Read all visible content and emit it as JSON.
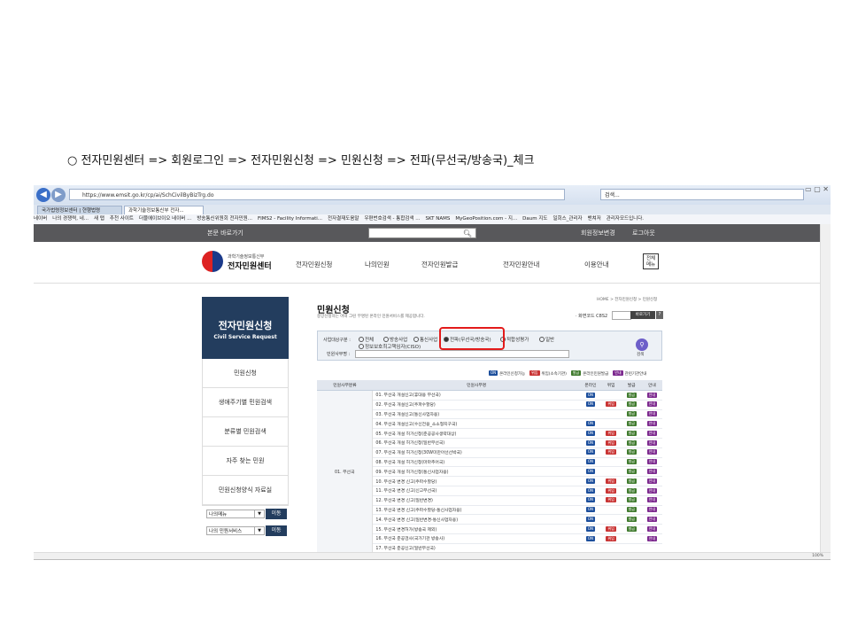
{
  "caption": "○  전자민원센터 => 회원로그인 => 전자민원신청 => 민원신청 => 전파(무선국/방송국)_체크",
  "browser": {
    "back_icon": "back-arrow-icon",
    "url": "https://www.emsit.go.kr/cp/ai/SchCivilByBizTrg.do",
    "search_placeholder": "검색...",
    "tabs": [
      "국가법령정보센터 | 현행법령",
      "과학기술정보통신부 전자..."
    ],
    "favorites": [
      "네이버",
      "나의 경쟁력, 네...",
      "새 탭",
      "추천 사이트",
      "더블에이브이오 네이버 ...",
      "방송통신위원회 전자민원...",
      "FIMS2 - Facility Informati...",
      "전자결재도움말",
      "우편번호검색 - 통합검색 ...",
      "SKT NAMS",
      "MyGeoPosition.com - 지...",
      "Daum 지도",
      "일회스_관리자",
      "밴쳐저",
      "관리자모드입니다."
    ],
    "zoom": "100%"
  },
  "topbar": {
    "skip": "본문 바로가기",
    "profile": "회원정보변경",
    "logout": "로그아웃"
  },
  "site": {
    "org": "과학기술정보통신부",
    "name": "전자민원센터",
    "allmenu": "전체 메뉴"
  },
  "gnb": [
    "전자민원신청",
    "나의민원",
    "전자민원발급",
    "전자민원안내",
    "이용안내"
  ],
  "left": {
    "title": "전자민원신청",
    "subtitle": "Civil Service Request",
    "nav": [
      "민원신청",
      "생애주기별 민원검색",
      "분류별 민원검색",
      "자주 찾는 민원",
      "민원신청양식 자료실"
    ],
    "select1": "나의메뉴",
    "select2": "나의 민원서비스",
    "go": "이동"
  },
  "content": {
    "breadcrumb": "HOME > 전자민원신청 > 민원신청",
    "title": "민원신청",
    "desc": "중앙신청하는 어떠 그린 무명된 온라인 민원서비스를 제공합니다.",
    "screen_code_label": "· 화면코드 C8S2",
    "move": "바로가기",
    "help": "?",
    "filter_label": "사업대상구분 :",
    "filter_options": [
      "전체",
      "방송사업",
      "통신사업",
      "전파(무선국/방송국)",
      "적합성평가",
      "일반",
      "정보보호최고책임자(CISO)"
    ],
    "filter_selected": 3,
    "name_label": "민원사무명 :",
    "search": "검색"
  },
  "legend": [
    {
      "badge": "ON",
      "text": "온라인신청가능",
      "color": "#1d4f9c"
    },
    {
      "badge": "위임",
      "text": "위임(소속기관)",
      "color": "#c93434"
    },
    {
      "badge": "발급",
      "text": "온라인민원발급",
      "color": "#3f7a2d"
    },
    {
      "badge": "안내",
      "text": "관련기관안내",
      "color": "#7d2a8f"
    }
  ],
  "table": {
    "headers": [
      "민원사무분류",
      "민원사무명",
      "온라인",
      "위임",
      "발급",
      "안내"
    ],
    "category": "01. 무선국",
    "rows": [
      {
        "name": "01. 무선국 개설신고(휴대용 무선국)",
        "on": true,
        "wi": false,
        "ba": true,
        "in": true
      },
      {
        "name": "02. 무선국 개설신고(주파수할당)",
        "on": true,
        "wi": true,
        "ba": true,
        "in": true
      },
      {
        "name": "03. 무선국 개설신고(통신사업자용)",
        "on": false,
        "wi": false,
        "ba": true,
        "in": true
      },
      {
        "name": "04. 무선국 개설신고(수신전용_소소형지구국)",
        "on": true,
        "wi": false,
        "ba": true,
        "in": true
      },
      {
        "name": "05. 무선국 개설 허가신청(준공공사생략대상)",
        "on": true,
        "wi": true,
        "ba": true,
        "in": true
      },
      {
        "name": "06. 무선국 개설 허가신청(일반무선국)",
        "on": true,
        "wi": true,
        "ba": true,
        "in": true
      },
      {
        "name": "07. 무선국 개설 허가신청(30W미만아선선박국)",
        "on": true,
        "wi": true,
        "ba": true,
        "in": true
      },
      {
        "name": "08. 무선국 개설 허가신청(마마추어국)",
        "on": true,
        "wi": false,
        "ba": true,
        "in": true
      },
      {
        "name": "09. 무선국 개설 허가신청(통신사업자용)",
        "on": true,
        "wi": false,
        "ba": true,
        "in": true
      },
      {
        "name": "10. 무선국 변경 신고(주파수할당)",
        "on": true,
        "wi": true,
        "ba": true,
        "in": true
      },
      {
        "name": "11. 무선국 변경 신고(신고무선국)",
        "on": true,
        "wi": true,
        "ba": true,
        "in": true
      },
      {
        "name": "12. 무선국 변경 신고(일반변경)",
        "on": true,
        "wi": true,
        "ba": true,
        "in": true
      },
      {
        "name": "13. 무선국 변경 신고(주파수할당-통신사업자용)",
        "on": true,
        "wi": false,
        "ba": true,
        "in": true
      },
      {
        "name": "14. 무선국 변경 신고(일반변경-통신사업자용)",
        "on": true,
        "wi": false,
        "ba": true,
        "in": true
      },
      {
        "name": "15. 무선국 변경허가(방송국 제외)",
        "on": true,
        "wi": true,
        "ba": true,
        "in": true
      },
      {
        "name": "16. 무선국 준공검사(국가기관 방송사)",
        "on": true,
        "wi": true,
        "ba": false,
        "in": true
      },
      {
        "name": "17. 무선국 준공신고(일반무선국)",
        "on": false,
        "wi": false,
        "ba": false,
        "in": false
      }
    ]
  }
}
